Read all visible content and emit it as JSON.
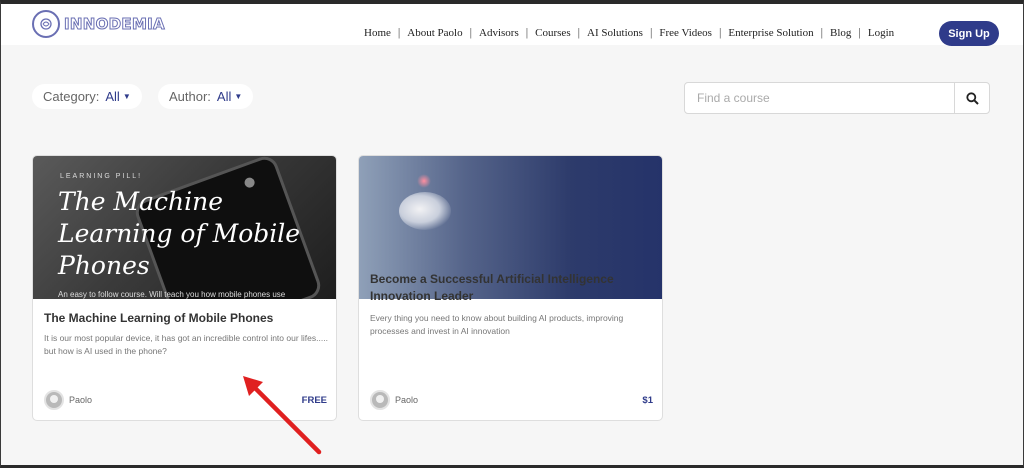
{
  "header": {
    "brand": "INNODEMIA",
    "nav": [
      "Home",
      "About Paolo",
      "Advisors",
      "Courses",
      "AI Solutions",
      "Free Videos",
      "Enterprise Solution",
      "Blog",
      "Login"
    ],
    "signup_label": "Sign Up"
  },
  "filters": {
    "category_label": "Category:",
    "category_value": "All",
    "author_label": "Author:",
    "author_value": "All"
  },
  "search": {
    "placeholder": "Find a course",
    "icon": "search-icon"
  },
  "courses": [
    {
      "image_eyebrow": "LEARNING PILL!",
      "image_title": "The Machine Learning of Mobile Phones",
      "image_subtitle": "An easy to follow course. Will teach you how mobile phones use",
      "title": "The Machine Learning of Mobile Phones",
      "description": "It is our most popular device, it has got an incredible control into our lifes..... but how is AI used in the phone?",
      "author": "Paolo",
      "price": "FREE"
    },
    {
      "title": "Become a Successful Artificial Intelligence Innovation Leader",
      "description": "Every thing you need to know about building AI products, improving processes and invest in AI innovation",
      "author": "Paolo",
      "price": "$1"
    }
  ],
  "colors": {
    "accent": "#2f3b8a",
    "annotation_arrow": "#e02020"
  }
}
